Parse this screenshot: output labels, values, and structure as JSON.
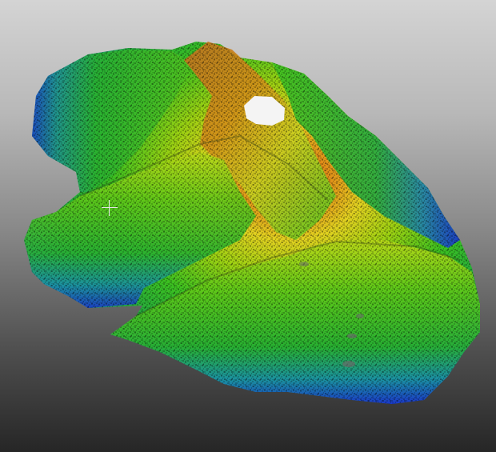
{
  "viewer": {
    "background_top": "#d4d4d4",
    "background_bottom": "#262626"
  },
  "point_cloud": {
    "colormap": [
      "#1a2fd0",
      "#1f8fb0",
      "#22b040",
      "#38c020",
      "#90d010",
      "#e0e020",
      "#e8a010",
      "#d05010",
      "#7a3a10"
    ],
    "hole_color": "#f4f4f4"
  },
  "cursor": {
    "icon": "crosshair-icon"
  }
}
